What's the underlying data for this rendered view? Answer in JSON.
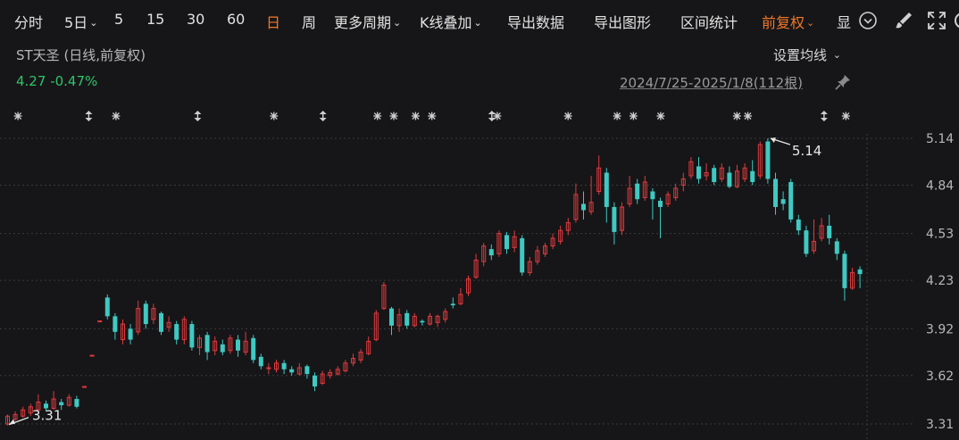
{
  "toolbar": {
    "items": [
      {
        "label": "分时"
      },
      {
        "label": "5日",
        "chev": "⌄"
      },
      {
        "label": "5"
      },
      {
        "label": "15"
      },
      {
        "label": "30"
      },
      {
        "label": "60"
      },
      {
        "label": "日"
      },
      {
        "label": "周"
      },
      {
        "label": "更多周期",
        "chev": "⌄"
      },
      {
        "label": "K线叠加",
        "chev": "⌄"
      },
      {
        "label": "导出数据"
      },
      {
        "label": "导出图形"
      },
      {
        "label": "区间统计"
      },
      {
        "label": "前复权",
        "chev": "⌄"
      },
      {
        "label": "显"
      }
    ],
    "active_item": "日",
    "icons": [
      "chevron-circle-icon",
      "brush-icon",
      "expand-icon",
      "settings-icon"
    ]
  },
  "header": {
    "stock_title": "ST天圣 (日线,前复权)",
    "ma_setting": "设置均线",
    "ma_chev": "⌄",
    "price": "4.27",
    "change": "-0.47%",
    "range": "2024/7/25-2025/1/8(112根)"
  },
  "colors": {
    "background": "#161618",
    "up": "#e03a3e",
    "down": "#3fc9c2",
    "accent": "#f0782a",
    "quote_green": "#2fc36a"
  },
  "chart_data": {
    "type": "candlestick",
    "ylim": [
      3.28,
      5.24
    ],
    "y_ticks": [
      "5.14",
      "4.84",
      "4.53",
      "4.23",
      "3.92",
      "3.62",
      "3.31"
    ],
    "y_tick_values": [
      5.14,
      4.84,
      4.53,
      4.23,
      3.92,
      3.62,
      3.31
    ],
    "max_label": "5.14",
    "min_label": "3.31",
    "candles": [
      [
        3.31,
        3.36,
        3.3,
        3.37
      ],
      [
        3.34,
        3.37,
        3.33,
        3.39
      ],
      [
        3.36,
        3.4,
        3.35,
        3.42
      ],
      [
        3.38,
        3.42,
        3.36,
        3.44
      ],
      [
        3.4,
        3.45,
        3.39,
        3.5
      ],
      [
        3.44,
        3.41,
        3.39,
        3.46
      ],
      [
        3.41,
        3.47,
        3.4,
        3.52
      ],
      [
        3.45,
        3.43,
        3.4,
        3.47
      ],
      [
        3.43,
        3.48,
        3.42,
        3.5
      ],
      [
        3.47,
        3.42,
        3.41,
        3.49
      ],
      [
        3.55,
        3.55,
        3.55,
        3.55
      ],
      [
        3.75,
        3.75,
        3.75,
        3.75
      ],
      [
        3.97,
        3.97,
        3.97,
        3.97
      ],
      [
        4.12,
        4.0,
        3.98,
        4.14
      ],
      [
        4.0,
        3.9,
        3.85,
        4.02
      ],
      [
        3.85,
        3.95,
        3.82,
        3.98
      ],
      [
        3.92,
        3.85,
        3.82,
        3.95
      ],
      [
        3.9,
        4.05,
        3.88,
        4.1
      ],
      [
        4.08,
        3.95,
        3.92,
        4.1
      ],
      [
        3.98,
        4.05,
        3.95,
        4.08
      ],
      [
        4.02,
        3.9,
        3.88,
        4.03
      ],
      [
        3.93,
        3.96,
        3.9,
        4.0
      ],
      [
        3.95,
        3.85,
        3.82,
        3.97
      ],
      [
        3.85,
        3.98,
        3.82,
        4.0
      ],
      [
        3.95,
        3.8,
        3.78,
        3.97
      ],
      [
        3.8,
        3.86,
        3.75,
        3.88
      ],
      [
        3.88,
        3.77,
        3.72,
        3.9
      ],
      [
        3.78,
        3.84,
        3.75,
        3.87
      ],
      [
        3.82,
        3.77,
        3.75,
        3.85
      ],
      [
        3.78,
        3.86,
        3.76,
        3.88
      ],
      [
        3.85,
        3.78,
        3.74,
        3.88
      ],
      [
        3.77,
        3.84,
        3.75,
        3.9
      ],
      [
        3.86,
        3.72,
        3.7,
        3.88
      ],
      [
        3.74,
        3.68,
        3.66,
        3.76
      ],
      [
        3.67,
        3.67,
        3.63,
        3.7
      ],
      [
        3.66,
        3.7,
        3.64,
        3.72
      ],
      [
        3.7,
        3.66,
        3.63,
        3.72
      ],
      [
        3.66,
        3.64,
        3.62,
        3.68
      ],
      [
        3.63,
        3.67,
        3.62,
        3.7
      ],
      [
        3.68,
        3.63,
        3.6,
        3.69
      ],
      [
        3.62,
        3.55,
        3.52,
        3.64
      ],
      [
        3.57,
        3.63,
        3.56,
        3.65
      ],
      [
        3.62,
        3.64,
        3.6,
        3.66
      ],
      [
        3.63,
        3.66,
        3.62,
        3.68
      ],
      [
        3.65,
        3.7,
        3.64,
        3.72
      ],
      [
        3.7,
        3.73,
        3.68,
        3.76
      ],
      [
        3.72,
        3.77,
        3.7,
        3.79
      ],
      [
        3.76,
        3.84,
        3.75,
        3.87
      ],
      [
        3.85,
        4.02,
        3.84,
        4.04
      ],
      [
        4.05,
        4.2,
        4.04,
        4.22
      ],
      [
        4.05,
        3.94,
        3.88,
        4.06
      ],
      [
        3.94,
        4.01,
        3.9,
        4.05
      ],
      [
        4.02,
        3.94,
        3.92,
        4.04
      ],
      [
        3.94,
        4.0,
        3.93,
        4.02
      ],
      [
        3.97,
        3.96,
        3.94,
        3.98
      ],
      [
        3.95,
        4.0,
        3.94,
        4.02
      ],
      [
        3.96,
        4.0,
        3.93,
        4.01
      ],
      [
        3.98,
        4.03,
        3.96,
        4.05
      ],
      [
        4.08,
        4.07,
        4.05,
        4.12
      ],
      [
        4.08,
        4.14,
        4.07,
        4.18
      ],
      [
        4.15,
        4.24,
        4.13,
        4.26
      ],
      [
        4.25,
        4.36,
        4.24,
        4.4
      ],
      [
        4.35,
        4.45,
        4.32,
        4.47
      ],
      [
        4.43,
        4.39,
        4.36,
        4.46
      ],
      [
        4.4,
        4.53,
        4.38,
        4.55
      ],
      [
        4.52,
        4.43,
        4.4,
        4.54
      ],
      [
        4.44,
        4.51,
        4.41,
        4.55
      ],
      [
        4.5,
        4.28,
        4.26,
        4.52
      ],
      [
        4.28,
        4.35,
        4.26,
        4.38
      ],
      [
        4.35,
        4.42,
        4.33,
        4.45
      ],
      [
        4.4,
        4.45,
        4.38,
        4.47
      ],
      [
        4.45,
        4.5,
        4.43,
        4.53
      ],
      [
        4.48,
        4.55,
        4.46,
        4.58
      ],
      [
        4.55,
        4.6,
        4.52,
        4.63
      ],
      [
        4.62,
        4.78,
        4.6,
        4.85
      ],
      [
        4.72,
        4.68,
        4.62,
        4.8
      ],
      [
        4.67,
        4.73,
        4.65,
        4.9
      ],
      [
        4.8,
        4.95,
        4.78,
        5.03
      ],
      [
        4.92,
        4.7,
        4.6,
        4.95
      ],
      [
        4.7,
        4.54,
        4.46,
        4.73
      ],
      [
        4.55,
        4.7,
        4.52,
        4.73
      ],
      [
        4.72,
        4.82,
        4.7,
        4.9
      ],
      [
        4.85,
        4.75,
        4.72,
        4.88
      ],
      [
        4.76,
        4.86,
        4.74,
        4.9
      ],
      [
        4.8,
        4.75,
        4.62,
        4.82
      ],
      [
        4.74,
        4.7,
        4.5,
        4.76
      ],
      [
        4.72,
        4.78,
        4.7,
        4.8
      ],
      [
        4.76,
        4.82,
        4.74,
        4.85
      ],
      [
        4.84,
        4.88,
        4.8,
        4.92
      ],
      [
        4.9,
        4.99,
        4.88,
        5.02
      ],
      [
        4.96,
        4.88,
        4.85,
        5.02
      ],
      [
        4.9,
        4.92,
        4.87,
        4.98
      ],
      [
        4.95,
        4.86,
        4.84,
        4.97
      ],
      [
        4.88,
        4.95,
        4.86,
        4.98
      ],
      [
        4.92,
        4.83,
        4.82,
        4.96
      ],
      [
        4.83,
        4.93,
        4.82,
        4.97
      ],
      [
        4.88,
        4.95,
        4.86,
        4.98
      ],
      [
        4.93,
        4.86,
        4.84,
        5.0
      ],
      [
        4.9,
        5.1,
        4.88,
        5.12
      ],
      [
        5.12,
        4.88,
        4.85,
        5.14
      ],
      [
        4.88,
        4.7,
        4.65,
        4.92
      ],
      [
        4.75,
        4.72,
        4.68,
        4.8
      ],
      [
        4.86,
        4.62,
        4.6,
        4.88
      ],
      [
        4.62,
        4.55,
        4.52,
        4.65
      ],
      [
        4.55,
        4.4,
        4.38,
        4.58
      ],
      [
        4.42,
        4.48,
        4.4,
        4.62
      ],
      [
        4.5,
        4.58,
        4.48,
        4.63
      ],
      [
        4.58,
        4.5,
        4.46,
        4.65
      ],
      [
        4.48,
        4.4,
        4.36,
        4.5
      ],
      [
        4.4,
        4.18,
        4.1,
        4.42
      ],
      [
        4.18,
        4.28,
        4.17,
        4.31
      ],
      [
        4.3,
        4.27,
        4.18,
        4.32
      ]
    ],
    "markers": [
      {
        "i": 1,
        "type": "asterisk"
      },
      {
        "i": 14,
        "type": "arrow"
      },
      {
        "i": 19,
        "type": "asterisk"
      },
      {
        "i": 34,
        "type": "arrow"
      },
      {
        "i": 48,
        "type": "asterisk"
      },
      {
        "i": 57,
        "type": "arrow"
      },
      {
        "i": 67,
        "type": "asterisk"
      },
      {
        "i": 70,
        "type": "asterisk"
      },
      {
        "i": 74,
        "type": "asterisk"
      },
      {
        "i": 77,
        "type": "asterisk"
      },
      {
        "i": 88,
        "type": "arrow"
      },
      {
        "i": 89,
        "type": "asterisk"
      },
      {
        "i": 102,
        "type": "asterisk"
      },
      {
        "i": 111,
        "type": "asterisk"
      },
      {
        "i": 114,
        "type": "asterisk"
      },
      {
        "i": 119,
        "type": "asterisk"
      },
      {
        "i": 133,
        "type": "asterisk"
      },
      {
        "i": 135,
        "type": "asterisk"
      },
      {
        "i": 149,
        "type": "arrow"
      },
      {
        "i": 153,
        "type": "asterisk"
      }
    ]
  }
}
